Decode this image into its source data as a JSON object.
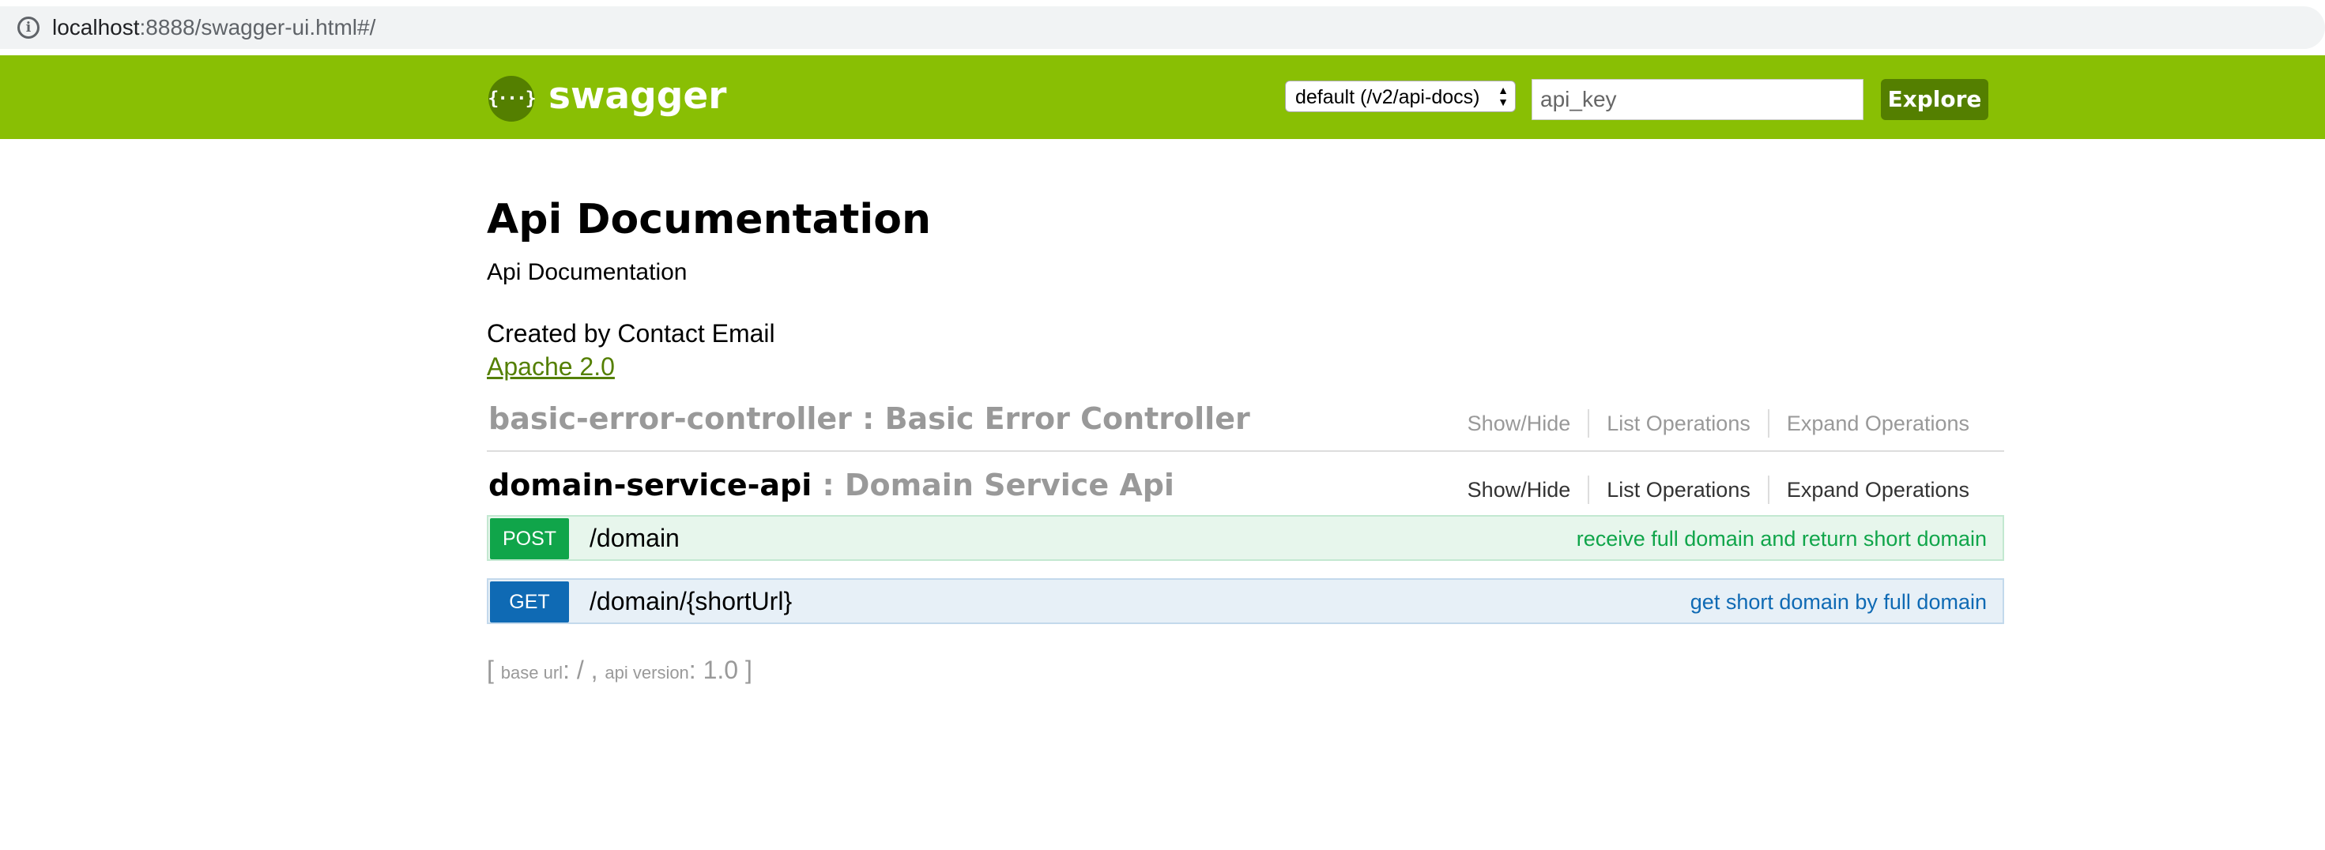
{
  "browser": {
    "url_host": "localhost",
    "url_rest": ":8888/swagger-ui.html#/",
    "info_icon": "info-icon"
  },
  "header": {
    "logo_glyph": "{···}",
    "logo_text": "swagger",
    "spec_select_value": "default (/v2/api-docs)",
    "api_key_placeholder": "api_key",
    "explore_label": "Explore",
    "brand_color": "#89bf04"
  },
  "info": {
    "title": "Api Documentation",
    "description": "Api Documentation",
    "contact": "Created by Contact Email",
    "license": "Apache 2.0"
  },
  "resources": [
    {
      "name": "basic-error-controller",
      "separator_desc": " : Basic Error Controller",
      "show_hide": "Show/Hide",
      "list_ops": "List Operations",
      "expand_ops": "Expand Operations"
    },
    {
      "name": "domain-service-api",
      "separator_desc": " : Domain Service Api",
      "show_hide": "Show/Hide",
      "list_ops": "List Operations",
      "expand_ops": "Expand Operations",
      "operations": [
        {
          "method": "POST",
          "path": "/domain",
          "summary": "receive full domain and return short domain",
          "color": "#10a54a"
        },
        {
          "method": "GET",
          "path": "/domain/{shortUrl}",
          "summary": "get short domain by full domain",
          "color": "#0f6ab4"
        }
      ]
    }
  ],
  "footer": {
    "open": "[ ",
    "base_url_label": "base url",
    "base_url_value": ": / , ",
    "api_version_label": "api version",
    "api_version_value": ": 1.0 ]"
  }
}
